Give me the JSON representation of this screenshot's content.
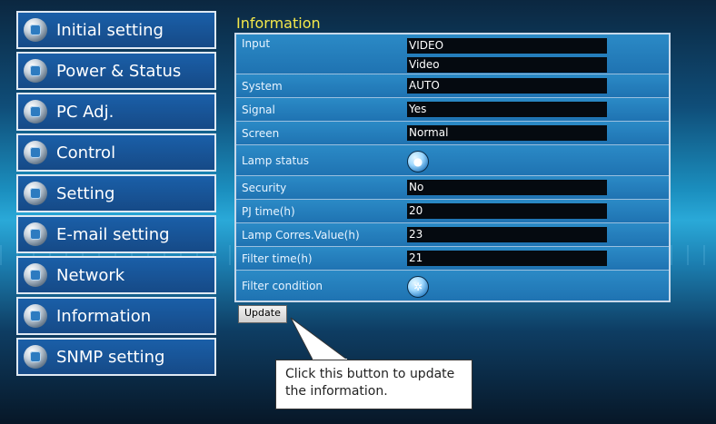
{
  "sidebar": {
    "items": [
      {
        "label": "Initial setting",
        "icon": "settings-icon"
      },
      {
        "label": "Power & Status",
        "icon": "power-icon"
      },
      {
        "label": "PC Adj.",
        "icon": "pc-icon"
      },
      {
        "label": "Control",
        "icon": "control-icon"
      },
      {
        "label": "Setting",
        "icon": "wrench-icon"
      },
      {
        "label": "E-mail setting",
        "icon": "mail-icon"
      },
      {
        "label": "Network",
        "icon": "network-icon"
      },
      {
        "label": "Information",
        "icon": "info-icon"
      },
      {
        "label": "SNMP setting",
        "icon": "snmp-icon"
      }
    ]
  },
  "info": {
    "title": "Information",
    "rows": [
      {
        "label": "Input",
        "value": "VIDEO"
      },
      {
        "label": "",
        "value": "Video"
      },
      {
        "label": "System",
        "value": "AUTO"
      },
      {
        "label": "Signal",
        "value": "Yes"
      },
      {
        "label": "Screen",
        "value": "Normal"
      },
      {
        "label": "Lamp status",
        "value_icon": "lamp-status-icon"
      },
      {
        "label": "Security",
        "value": "No"
      },
      {
        "label": "PJ time(h)",
        "value": "20"
      },
      {
        "label": "Lamp Corres.Value(h)",
        "value": "23"
      },
      {
        "label": "Filter time(h)",
        "value": "21"
      },
      {
        "label": "Filter condition",
        "value_icon": "filter-condition-icon"
      }
    ]
  },
  "buttons": {
    "update": "Update"
  },
  "callout": {
    "text": "Click this button to update the information."
  },
  "colors": {
    "title": "#f4e84a",
    "sidebar_bg": "#1a5fa8",
    "value_bg": "#050a10"
  }
}
